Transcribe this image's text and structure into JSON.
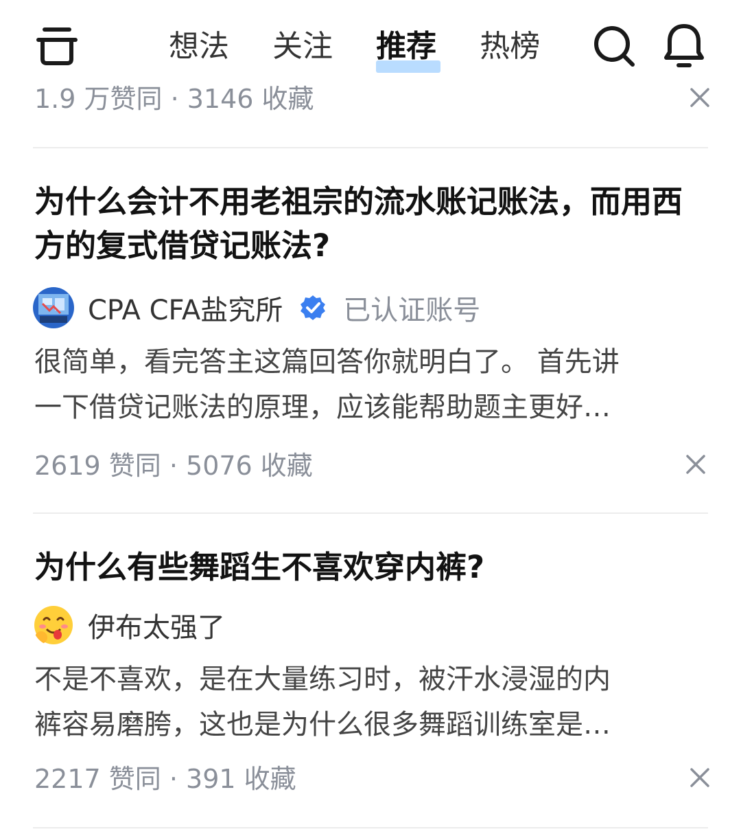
{
  "nav": {
    "tabs": [
      {
        "label": "想法"
      },
      {
        "label": "关注"
      },
      {
        "label": "推荐"
      },
      {
        "label": "热榜"
      }
    ],
    "active_tab": "推荐",
    "accent_underline_color": "#b9dcff",
    "icons": [
      "menu-icon",
      "search-icon",
      "bell-icon"
    ]
  },
  "cards": [
    {
      "stats": "1.9 万赞同 · 3146 收藏"
    },
    {
      "title": "为什么会计不用老祖宗的流水账记账法，而用西方的复式借贷记账法?",
      "author": "CPA CFA盐究所",
      "verified_label": "已认证账号",
      "excerpt_lines": [
        "很简单，看完答主这篇回答你就明白了。 首先讲",
        "一下借贷记账法的原理，应该能帮助题主更好…"
      ],
      "stats": "2619 赞同 · 5076 收藏"
    },
    {
      "title": "为什么有些舞蹈生不喜欢穿内裤?",
      "author": "伊布太强了",
      "excerpt_lines": [
        "不是不喜欢，是在大量练习时，被汗水浸湿的内",
        "裤容易磨胯，这也是为什么很多舞蹈训练室是…"
      ],
      "stats": "2217 赞同 · 391 收藏"
    }
  ]
}
